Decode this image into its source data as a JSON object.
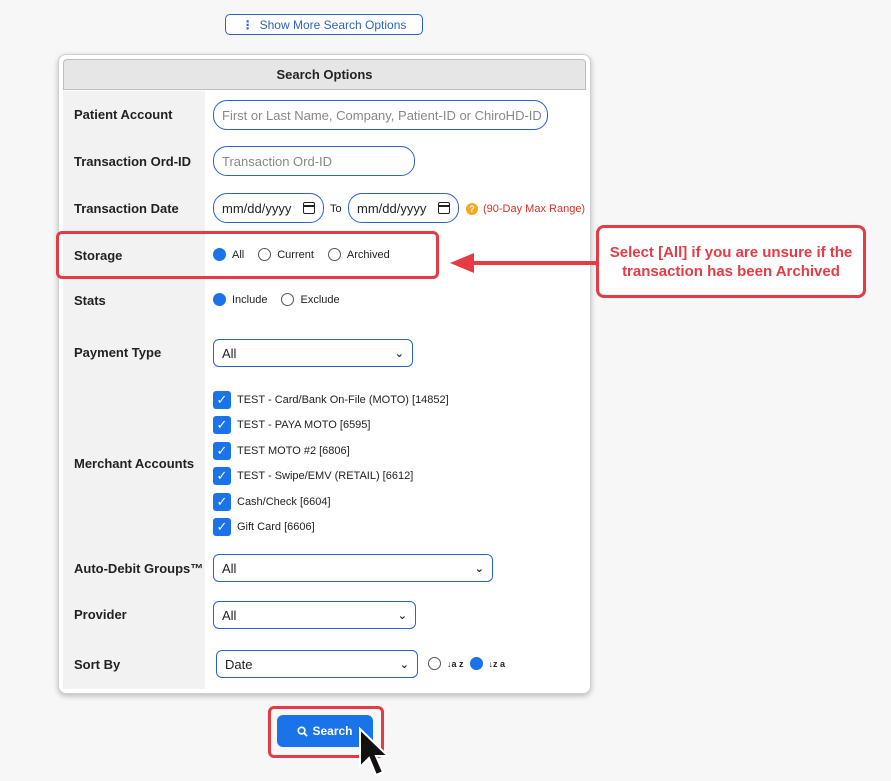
{
  "top_button": {
    "label": "Show More Search Options",
    "icon": "vertical-dots-icon"
  },
  "panel": {
    "title": "Search Options",
    "patient_account": {
      "label": "Patient Account",
      "placeholder": "First or Last Name, Company, Patient-ID or ChiroHD-ID"
    },
    "transaction_ord_id": {
      "label": "Transaction Ord-ID",
      "placeholder": "Transaction Ord-ID"
    },
    "transaction_date": {
      "label": "Transaction Date",
      "from_value": "mm/dd/yyyy",
      "to_label": "To",
      "to_value": "mm/dd/yyyy",
      "range_note": "(90-Day Max Range)"
    },
    "storage": {
      "label": "Storage",
      "options": [
        "All",
        "Current",
        "Archived"
      ],
      "selected": "All"
    },
    "stats": {
      "label": "Stats",
      "options": [
        "Include",
        "Exclude"
      ],
      "selected": "Include"
    },
    "payment_type": {
      "label": "Payment Type",
      "value": "All"
    },
    "merchant_accounts": {
      "label": "Merchant Accounts",
      "items": [
        "TEST - Card/Bank On-File (MOTO) [14852]",
        "TEST - PAYA MOTO [6595]",
        "TEST MOTO #2 [6806]",
        "TEST - Swipe/EMV (RETAIL) [6612]",
        "Cash/Check [6604]",
        "Gift Card [6606]"
      ]
    },
    "auto_debit_groups": {
      "label": "Auto-Debit Groups™",
      "value": "All"
    },
    "provider": {
      "label": "Provider",
      "value": "All"
    },
    "sort_by": {
      "label": "Sort By",
      "value": "Date",
      "asc_icon": "↓a z",
      "desc_icon": "↓z a",
      "selected": "desc"
    }
  },
  "callout": {
    "text": "Select [All] if you are unsure if the transaction has been Archived"
  },
  "search_button": {
    "label": "Search"
  },
  "colors": {
    "accent": "#1a73e8",
    "highlight": "#e53b45"
  }
}
